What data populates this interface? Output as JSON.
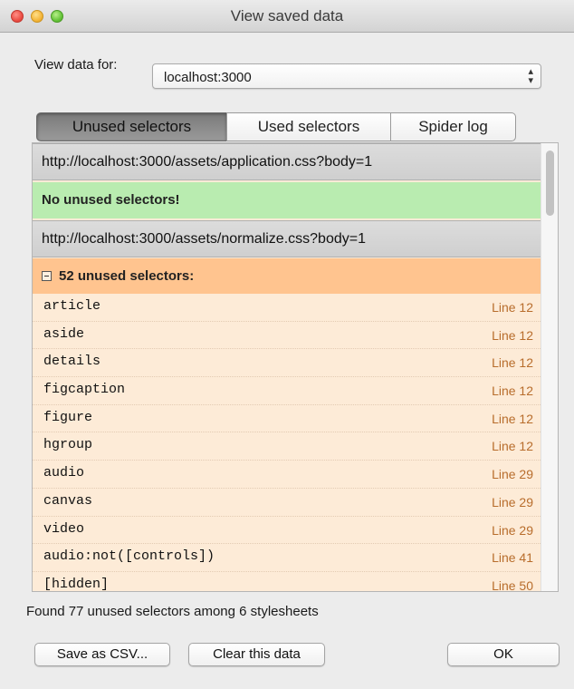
{
  "window": {
    "title": "View saved data"
  },
  "host": {
    "label": "View data for:",
    "value": "localhost:3000",
    "arrows": "⌃⌄"
  },
  "tabs": [
    {
      "label": "Unused selectors",
      "active": true
    },
    {
      "label": "Used selectors",
      "active": false
    },
    {
      "label": "Spider log",
      "active": false
    }
  ],
  "stylesheets": [
    {
      "url": "http://localhost:3000/assets/application.css?body=1",
      "status": "No unused selectors!"
    },
    {
      "url": "http://localhost:3000/assets/normalize.css?body=1",
      "status": "52 unused selectors:"
    }
  ],
  "selectors": [
    {
      "selector": "article",
      "line": "Line 12"
    },
    {
      "selector": "aside",
      "line": "Line 12"
    },
    {
      "selector": "details",
      "line": "Line 12"
    },
    {
      "selector": "figcaption",
      "line": "Line 12"
    },
    {
      "selector": "figure",
      "line": "Line 12"
    },
    {
      "selector": "hgroup",
      "line": "Line 12"
    },
    {
      "selector": "audio",
      "line": "Line 29"
    },
    {
      "selector": "canvas",
      "line": "Line 29"
    },
    {
      "selector": "video",
      "line": "Line 29"
    },
    {
      "selector": "audio:not([controls])",
      "line": "Line 41"
    },
    {
      "selector": "[hidden]",
      "line": "Line 50"
    }
  ],
  "summary": "Found 77 unused selectors among 6 stylesheets",
  "buttons": {
    "save_csv": "Save as CSV...",
    "clear": "Clear this data",
    "ok": "OK"
  },
  "colors": {
    "ok_row": "#b9ecb0",
    "warn_row": "#ffc48f",
    "list_bg": "#fdebd7",
    "line_text": "#b86d2c"
  }
}
